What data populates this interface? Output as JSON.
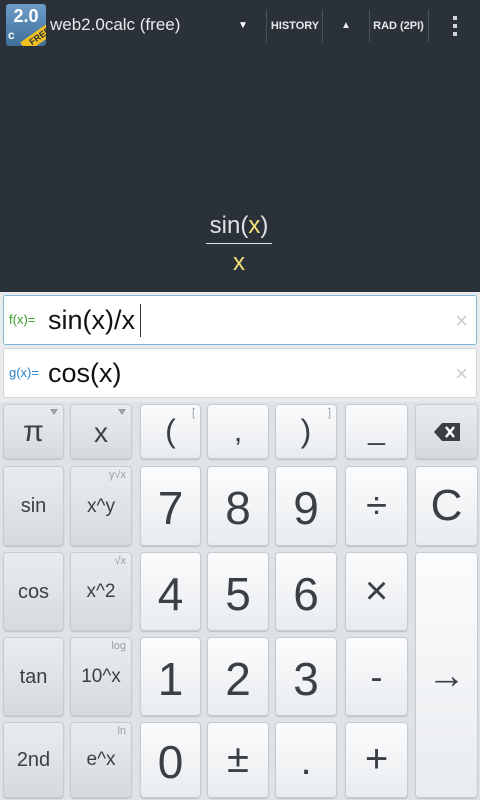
{
  "app": {
    "logo_main": "2.0",
    "logo_sub": "c",
    "logo_ribbon": "FREE",
    "title": "web2.0calc (free)",
    "dropdown_glyph": "▼",
    "history_label": "HISTORY",
    "up_glyph": "▲",
    "angle_mode_label": "RAD (2PI)"
  },
  "display": {
    "numerator_fn": "sin(",
    "numerator_var": "x",
    "numerator_close": ")",
    "denominator": "x"
  },
  "functions": {
    "f": {
      "label": "f(x)=",
      "value": "sin(x)/x"
    },
    "g": {
      "label": "g(x)=",
      "value": "cos(x)"
    },
    "clear_glyph": "×"
  },
  "keys": {
    "pi": "π",
    "x": "x",
    "open_paren": "(",
    "open_paren_alt": "[",
    "comma": ",",
    "close_paren": ")",
    "close_paren_alt": "]",
    "underscore": "_",
    "sin": "sin",
    "pow": "x^y",
    "pow_alt": "y√x",
    "seven": "7",
    "eight": "8",
    "nine": "9",
    "divide": "÷",
    "clear": "C",
    "cos": "cos",
    "square": "x^2",
    "square_alt": "√x",
    "four": "4",
    "five": "5",
    "six": "6",
    "multiply": "×",
    "tan": "tan",
    "tenpow": "10^x",
    "tenpow_alt": "log",
    "one": "1",
    "two": "2",
    "three": "3",
    "minus": "-",
    "enter": "→",
    "second": "2nd",
    "exp": "e^x",
    "exp_alt": "ln",
    "zero": "0",
    "plusminus": "±",
    "dot": ".",
    "plus": "+"
  },
  "colors": {
    "background": "#2b3138",
    "accent_f": "#3a9a2a",
    "accent_g": "#2a82c4",
    "variable_highlight": "#f4e27a"
  },
  "icons": [
    "dropdown-arrow-icon",
    "up-arrow-icon",
    "overflow-menu-icon",
    "backspace-icon",
    "clear-input-icon",
    "enter-arrow-icon",
    "dropdown-triangle-icon"
  ]
}
